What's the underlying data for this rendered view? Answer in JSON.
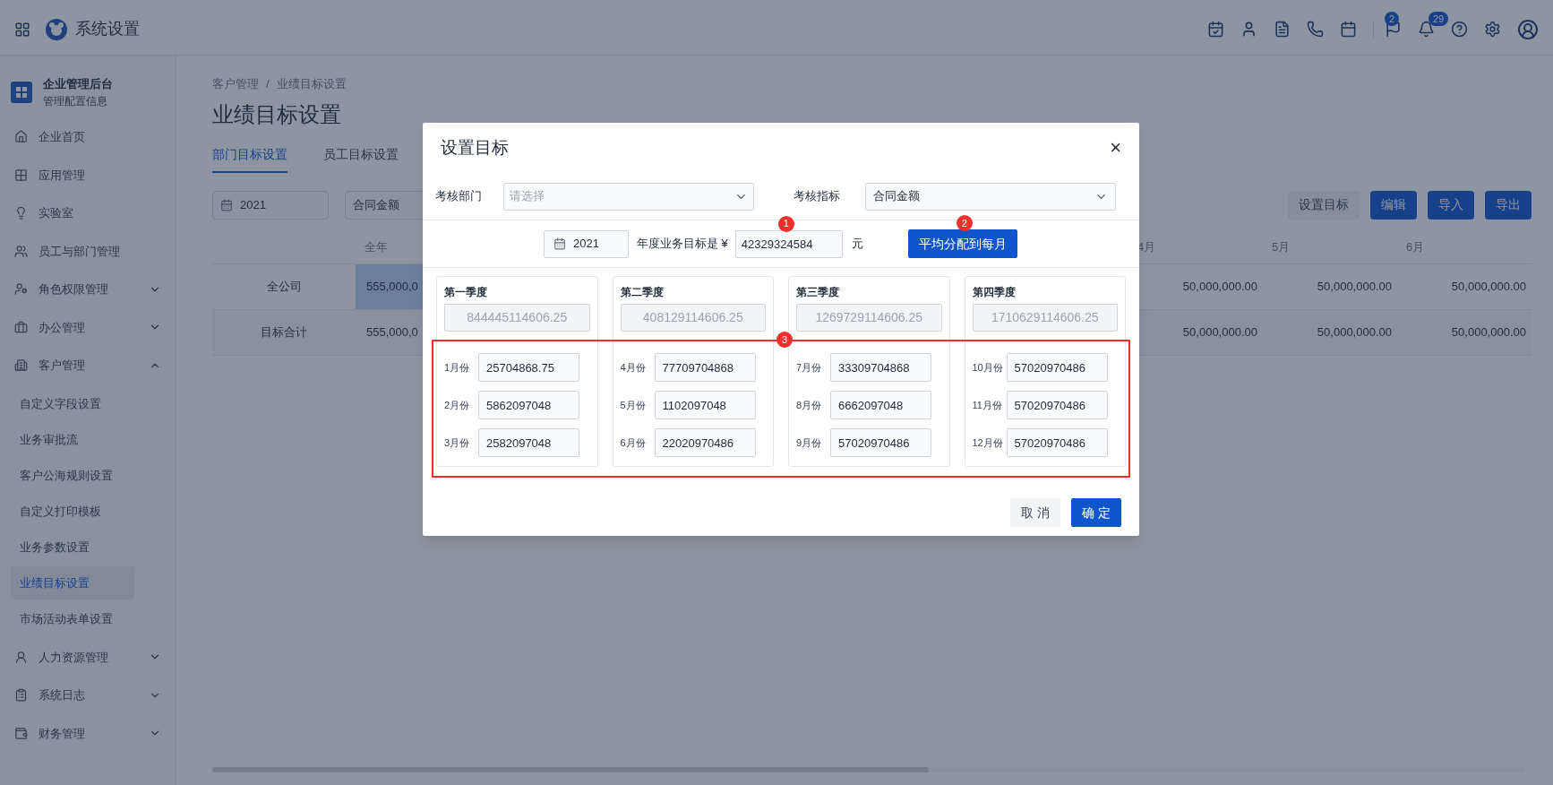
{
  "topbar": {
    "title": "系统设置",
    "icons": [
      {
        "kind": "calendar-check"
      },
      {
        "kind": "user"
      },
      {
        "kind": "document"
      },
      {
        "kind": "phone"
      },
      {
        "kind": "calendar"
      },
      {
        "kind": "flag",
        "badge": "2"
      },
      {
        "kind": "bell",
        "badge": "29"
      },
      {
        "kind": "help"
      },
      {
        "kind": "settings"
      },
      {
        "kind": "avatar"
      }
    ]
  },
  "sidebar": {
    "title": "企业管理后台",
    "subtitle": "管理配置信息",
    "items": [
      {
        "label": "企业首页",
        "kind": "link"
      },
      {
        "label": "应用管理",
        "kind": "link"
      },
      {
        "label": "实验室",
        "kind": "link"
      },
      {
        "label": "员工与部门管理",
        "kind": "link"
      },
      {
        "label": "角色权限管理",
        "kind": "group",
        "expanded": false
      },
      {
        "label": "办公管理",
        "kind": "group",
        "expanded": false
      },
      {
        "label": "客户管理",
        "kind": "group",
        "expanded": true,
        "children": [
          {
            "label": "自定义字段设置",
            "selected": false
          },
          {
            "label": "业务审批流",
            "selected": false
          },
          {
            "label": "客户公海规则设置",
            "selected": false
          },
          {
            "label": "自定义打印模板",
            "selected": false
          },
          {
            "label": "业务参数设置",
            "selected": false
          },
          {
            "label": "业绩目标设置",
            "selected": true
          },
          {
            "label": "市场活动表单设置",
            "selected": false
          }
        ]
      },
      {
        "label": "人力资源管理",
        "kind": "group",
        "expanded": false
      },
      {
        "label": "系统日志",
        "kind": "group",
        "expanded": false
      },
      {
        "label": "财务管理",
        "kind": "group",
        "expanded": false
      }
    ]
  },
  "main": {
    "breadcrumb": [
      "客户管理",
      "业绩目标设置"
    ],
    "separator": "/",
    "title": "业绩目标设置",
    "tabs": [
      {
        "label": "部门目标设置",
        "selected": true
      },
      {
        "label": "员工目标设置",
        "selected": false
      }
    ],
    "year": "2021",
    "metric": "合同金额",
    "buttons": [
      {
        "label": "设置目标",
        "kind": "secondary"
      },
      {
        "label": "编辑",
        "kind": "primary"
      },
      {
        "label": "导入",
        "kind": "primary"
      },
      {
        "label": "导出",
        "kind": "primary"
      }
    ],
    "table": {
      "columns": [
        "全年",
        "4月",
        "5月",
        "6月"
      ],
      "rows": [
        {
          "name": "全公司",
          "selected": true,
          "cells": [
            "555,000,0",
            "50,000,000.00",
            "50,000,000.00",
            "50,000,000.00"
          ]
        },
        {
          "name": "目标合计",
          "selected": false,
          "cells": [
            "555,000,0",
            "50,000,000.00",
            "50,000,000.00",
            "50,000,000.00"
          ]
        }
      ]
    }
  },
  "modal": {
    "title": "设置目标",
    "close": "×",
    "fields": [
      {
        "label": "考核部门",
        "placeholder": "请选择"
      },
      {
        "label": "考核指标",
        "value": "合同金额"
      }
    ],
    "year": "2021",
    "target_label": "年度业务目标是 ¥",
    "target_value": "42329324584",
    "unit": "元",
    "distribute_button": "平均分配到每月",
    "markers": [
      "1",
      "2",
      "3"
    ],
    "quarters": [
      {
        "title": "第一季度",
        "total": "844445114606.25",
        "months": [
          {
            "label": "1月份",
            "value": "25704868.75"
          },
          {
            "label": "2月份",
            "value": "5862097048"
          },
          {
            "label": "3月份",
            "value": "2582097048"
          }
        ]
      },
      {
        "title": "第二季度",
        "total": "408129114606.25",
        "months": [
          {
            "label": "4月份",
            "value": "77709704868"
          },
          {
            "label": "5月份",
            "value": "1102097048"
          },
          {
            "label": "6月份",
            "value": "22020970486"
          }
        ]
      },
      {
        "title": "第三季度",
        "total": "1269729114606.25",
        "months": [
          {
            "label": "7月份",
            "value": "33309704868"
          },
          {
            "label": "8月份",
            "value": "6662097048"
          },
          {
            "label": "9月份",
            "value": "57020970486"
          }
        ]
      },
      {
        "title": "第四季度",
        "total": "1710629114606.25",
        "months": [
          {
            "label": "10月份",
            "value": "57020970486"
          },
          {
            "label": "11月份",
            "value": "57020970486"
          },
          {
            "label": "12月份",
            "value": "57020970486"
          }
        ]
      }
    ],
    "cancel": "取 消",
    "ok": "确 定"
  }
}
